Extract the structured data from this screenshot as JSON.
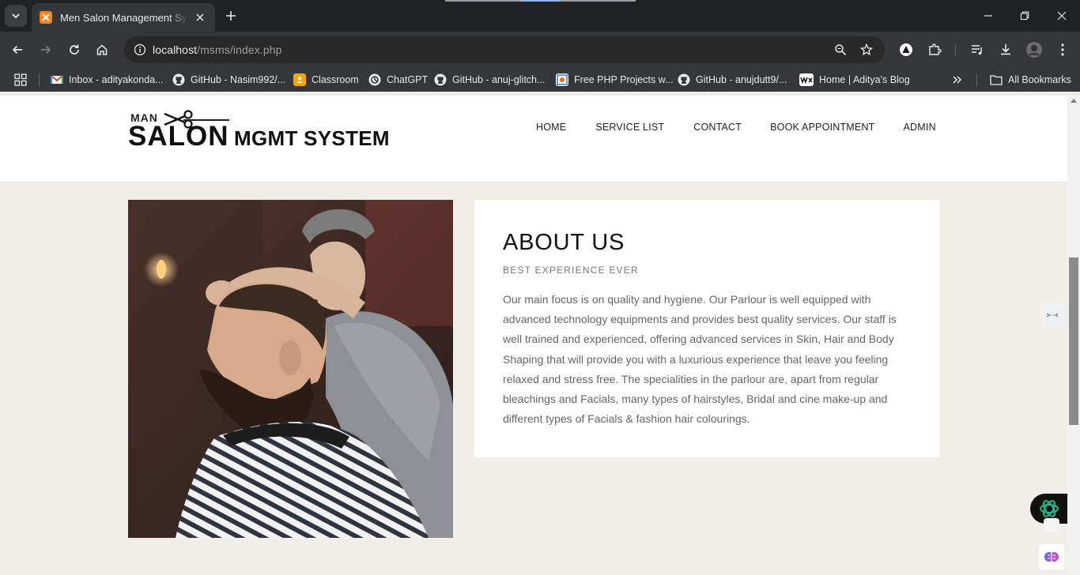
{
  "browser": {
    "tab_title": "Men Salon Management System",
    "url_host": "localhost",
    "url_path": "/msms/index.php",
    "bookmarks": [
      {
        "label": "Inbox - adityakonda...",
        "icon": "gmail-icon"
      },
      {
        "label": "GitHub - Nasim992/...",
        "icon": "github-icon"
      },
      {
        "label": "Classroom",
        "icon": "classroom-icon"
      },
      {
        "label": "ChatGPT",
        "icon": "chatgpt-icon"
      },
      {
        "label": "GitHub - anuj-glitch...",
        "icon": "github-icon"
      },
      {
        "label": "Free PHP Projects w...",
        "icon": "php-projects-icon"
      },
      {
        "label": "GitHub - anujdutt9/...",
        "icon": "github-icon"
      },
      {
        "label": "Home | Aditya's Blog",
        "icon": "wix-icon"
      }
    ],
    "all_bookmarks": "All Bookmarks"
  },
  "site": {
    "logo": {
      "man": "MAN",
      "salon": "SALON",
      "mgmt": "MGMT SYSTEM"
    },
    "nav": [
      "HOME",
      "SERVICE LIST",
      "CONTACT",
      "BOOK APPOINTMENT",
      "ADMIN"
    ],
    "about": {
      "title": "ABOUT US",
      "subtitle": "BEST EXPERIENCE EVER",
      "body": "Our main focus is on quality and hygiene. Our Parlour is well equipped with advanced technology equipments and provides best quality services. Our staff is well trained and experienced, offering advanced services in Skin, Hair and Body Shaping that will provide you with a luxurious experience that leave you feeling relaxed and stress free. The specialities in the parlour are, apart from regular bleachings and Facials, many types of hairstyles, Bridal and cine make-up and different types of Facials & fashion hair colourings."
    }
  },
  "colors": {
    "page_bg": "#f1eee9",
    "chrome_dark": "#202124",
    "chrome_toolbar": "#35363a",
    "card_bg": "#ffffff",
    "text_dark": "#111111",
    "text_muted": "#666666"
  }
}
